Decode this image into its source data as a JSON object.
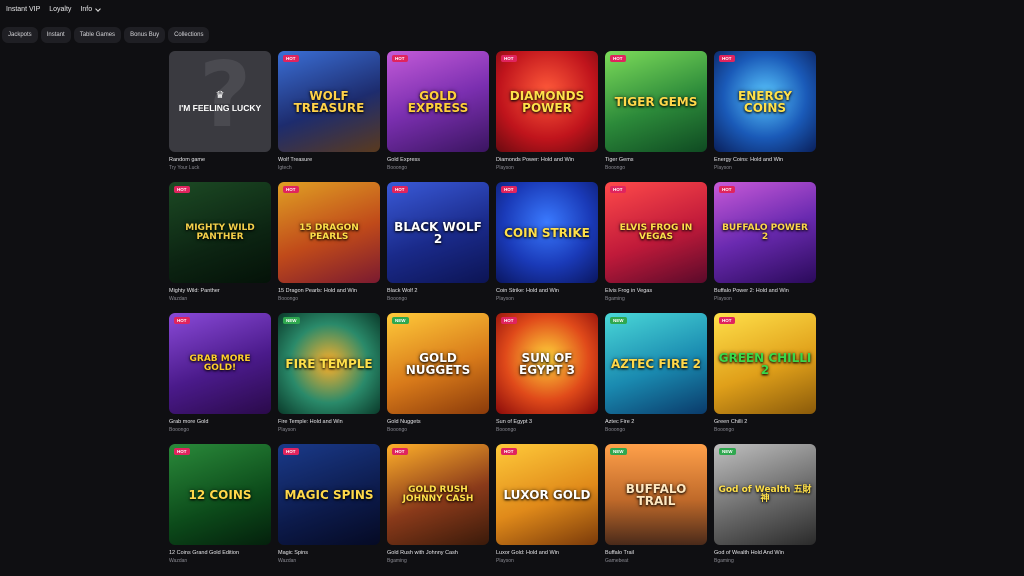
{
  "topnav": [
    {
      "label": "Instant VIP"
    },
    {
      "label": "Loyalty"
    },
    {
      "label": "Info"
    }
  ],
  "filters": [
    "Jackpots",
    "Instant",
    "Table Games",
    "Bonus Buy",
    "Collections"
  ],
  "games": [
    {
      "name": "Random game",
      "provider": "Try Your Luck",
      "badge": "",
      "title": "I'M FEELING LUCKY",
      "special": "lucky"
    },
    {
      "name": "Wolf Treasure",
      "provider": "Igtech",
      "badge": "HOT",
      "title": "WOLF TREASURE",
      "bg": "linear-gradient(160deg,#3b6fd6,#1d2c6e 55%,#5a3a1e)",
      "color": "#ffd24a"
    },
    {
      "name": "Gold Express",
      "provider": "Booongo",
      "badge": "HOT",
      "title": "GOLD EXPRESS",
      "bg": "linear-gradient(160deg,#c35bd8,#7b2fb0 50%,#3a1560)",
      "color": "#ffcf3a"
    },
    {
      "name": "Diamonds Power: Hold and Win",
      "provider": "Playson",
      "badge": "HOT",
      "title": "DIAMONDS POWER",
      "bg": "radial-gradient(circle at 50% 40%,#ff5a3a,#c0141c 60%,#6a0a10)",
      "color": "#ffe24a"
    },
    {
      "name": "Tiger Gems",
      "provider": "Booongo",
      "badge": "HOT",
      "title": "TIGER GEMS",
      "bg": "linear-gradient(160deg,#7ddc5a,#2c8a3a 55%,#0f4a22)",
      "color": "#ffd84a"
    },
    {
      "name": "Energy Coins: Hold and Win",
      "provider": "Playson",
      "badge": "HOT",
      "title": "ENERGY COINS",
      "bg": "radial-gradient(circle at 50% 45%,#5ac8ff,#1a5ab8 55%,#0a1f5a)",
      "color": "#ffe14a"
    },
    {
      "name": "Mighty Wild: Panther",
      "provider": "Wazdan",
      "badge": "HOT",
      "title": "MIGHTY WILD PANTHER",
      "bg": "linear-gradient(160deg,#1c4a24,#0c2412 60%,#041208)",
      "color": "#f4d04a"
    },
    {
      "name": "15 Dragon Pearls: Hold and Win",
      "provider": "Booongo",
      "badge": "HOT",
      "title": "15 DRAGON PEARLS",
      "bg": "linear-gradient(160deg,#e0a024,#c04a1a 55%,#7a1a30)",
      "color": "#ffe04a"
    },
    {
      "name": "Black Wolf 2",
      "provider": "Booongo",
      "badge": "HOT",
      "title": "BLACK WOLF 2",
      "bg": "linear-gradient(160deg,#3a5ad8,#1a2a8a 55%,#0c1454)",
      "color": "#ffffff"
    },
    {
      "name": "Coin Strike: Hold and Win",
      "provider": "Playson",
      "badge": "HOT",
      "title": "COIN STRIKE",
      "bg": "radial-gradient(circle at 50% 40%,#3a7aff,#1a3ab8 55%,#0a1660)",
      "color": "#ffe04a"
    },
    {
      "name": "Elvis Frog in Vegas",
      "provider": "Bgaming",
      "badge": "HOT",
      "title": "ELVIS FROG IN VEGAS",
      "bg": "linear-gradient(160deg,#ff4a4a,#c01a3a 55%,#5a0a2a)",
      "color": "#ffe04a"
    },
    {
      "name": "Buffalo Power 2: Hold and Win",
      "provider": "Playson",
      "badge": "HOT",
      "title": "BUFFALO POWER 2",
      "bg": "linear-gradient(160deg,#c85ad8,#6a2ab0 50%,#2a0a5a)",
      "color": "#ffd84a"
    },
    {
      "name": "Grab more Gold",
      "provider": "Booongo",
      "badge": "HOT",
      "title": "GRAB MORE GOLD!",
      "bg": "linear-gradient(160deg,#8a4ad8,#4a1a8a 55%,#2a0a4a)",
      "color": "#ffcf2a"
    },
    {
      "name": "Fire Temple: Hold and Win",
      "provider": "Playson",
      "badge": "NEW",
      "title": "FIRE TEMPLE",
      "bg": "radial-gradient(circle at 50% 50%,#ffb02a,#2a8a6a 55%,#0a3a2a)",
      "color": "#ffe04a"
    },
    {
      "name": "Gold Nuggets",
      "provider": "Booongo",
      "badge": "NEW",
      "title": "GOLD NUGGETS",
      "bg": "linear-gradient(160deg,#ffca3a,#d87a1a 55%,#8a3a0a)",
      "color": "#ffffff"
    },
    {
      "name": "Sun of Egypt 3",
      "provider": "Booongo",
      "badge": "HOT",
      "title": "SUN OF EGYPT 3",
      "bg": "radial-gradient(circle at 50% 45%,#ffd43a,#e04a1a 55%,#8a0a0a)",
      "color": "#ffffff"
    },
    {
      "name": "Aztec Fire 2",
      "provider": "Booongo",
      "badge": "NEW",
      "title": "AZTEC FIRE 2",
      "bg": "linear-gradient(160deg,#4ad8d8,#1a8ab0 55%,#0a3a6a)",
      "color": "#ffd84a"
    },
    {
      "name": "Green Chilli 2",
      "provider": "Booongo",
      "badge": "HOT",
      "title": "GREEN CHILLI 2",
      "bg": "linear-gradient(160deg,#ffe04a,#e0a01a 55%,#8a5a0a)",
      "color": "#3ad84a"
    },
    {
      "name": "12 Coins Grand Gold Edition",
      "provider": "Wazdan",
      "badge": "HOT",
      "title": "12 COINS",
      "bg": "linear-gradient(160deg,#2a8a3a,#0c4a1a 60%,#04200c)",
      "color": "#ffd84a"
    },
    {
      "name": "Magic Spins",
      "provider": "Wazdan",
      "badge": "HOT",
      "title": "MAGIC SPINS",
      "bg": "linear-gradient(160deg,#1a3a8a,#0c1a4a 60%,#050a24)",
      "color": "#ffd84a"
    },
    {
      "name": "Gold Rush with Johnny Cash",
      "provider": "Bgaming",
      "badge": "HOT",
      "title": "GOLD RUSH JOHNNY CASH",
      "bg": "linear-gradient(160deg,#ffb02a,#8a3a1a 55%,#3a1a0a)",
      "color": "#ffe04a"
    },
    {
      "name": "Luxor Gold: Hold and Win",
      "provider": "Playson",
      "badge": "HOT",
      "title": "LUXOR GOLD",
      "bg": "linear-gradient(160deg,#ffca3a,#e08a1a 55%,#7a3a0a)",
      "color": "#ffffff"
    },
    {
      "name": "Buffalo Trail",
      "provider": "Gamebeat",
      "badge": "NEW",
      "title": "BUFFALO TRAIL",
      "bg": "linear-gradient(180deg,#ffa04a,#c06a2a 55%,#4a2a1a)",
      "color": "#ffe8c0"
    },
    {
      "name": "God of Wealth Hold And Win",
      "provider": "Bgaming",
      "badge": "NEW",
      "title": "God of Wealth 五財神",
      "bg": "linear-gradient(160deg,#c0c0c0,#6a6a6a 55%,#2a2a2a)",
      "color": "#ffe04a"
    }
  ]
}
